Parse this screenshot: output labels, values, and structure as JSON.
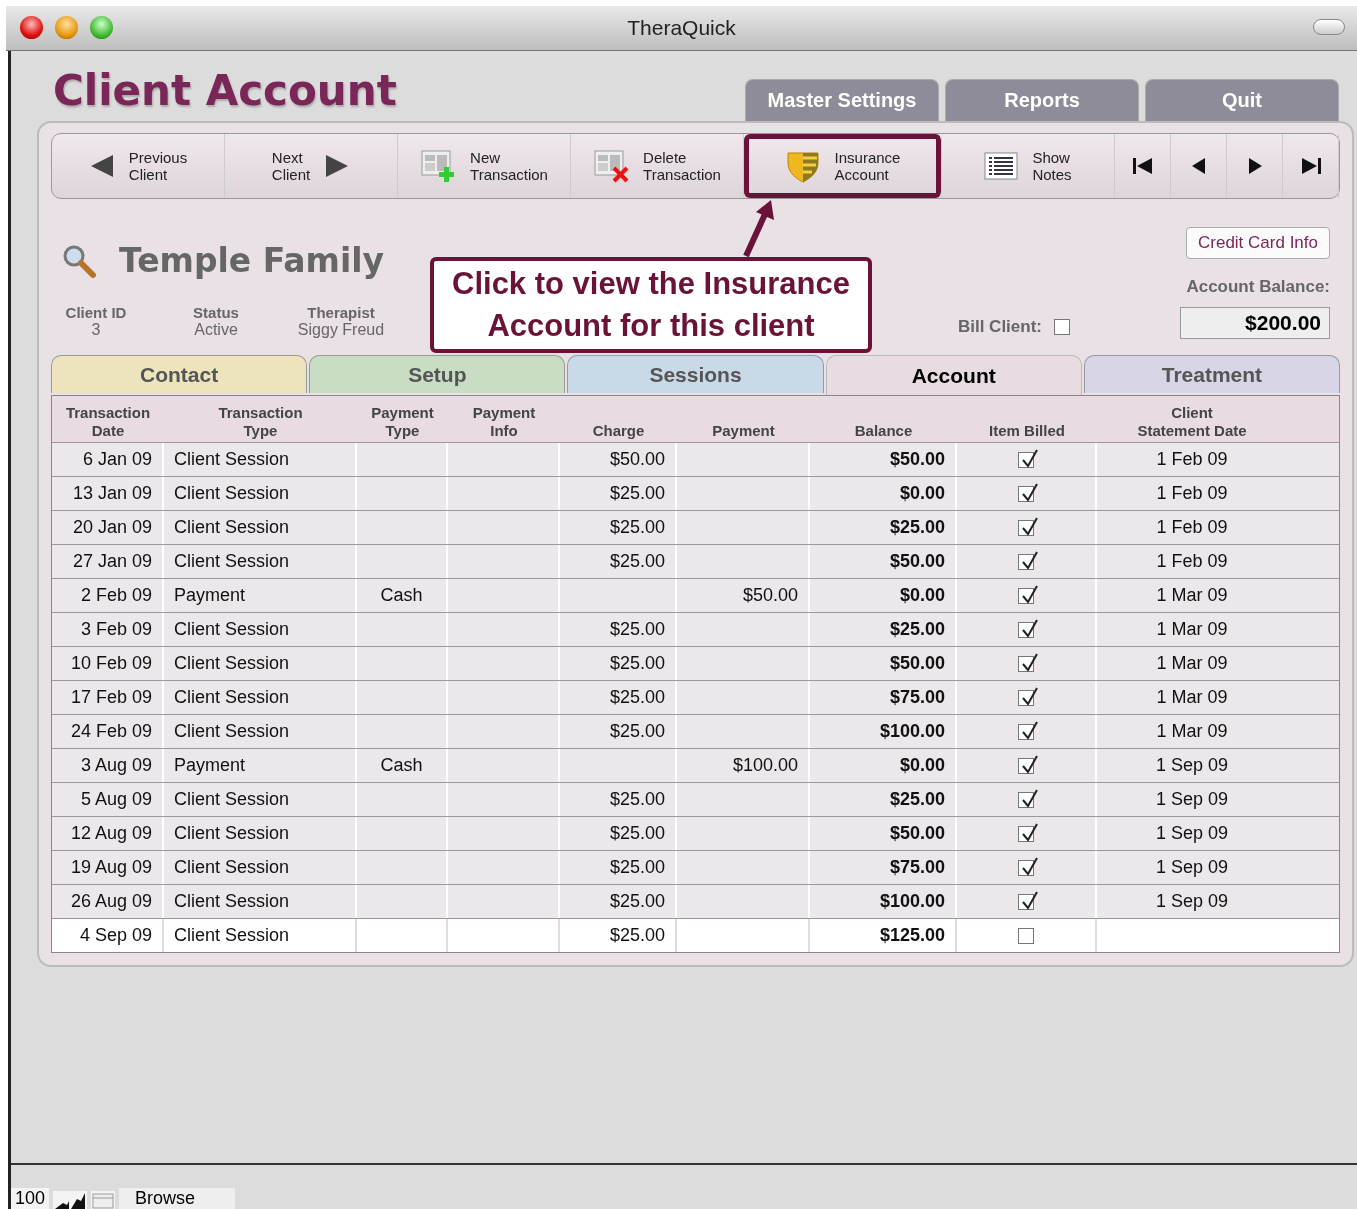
{
  "window": {
    "title": "TheraQuick"
  },
  "header": {
    "title": "Client Account"
  },
  "top_tabs": [
    {
      "label": "Master Settings"
    },
    {
      "label": "Reports"
    },
    {
      "label": "Quit"
    }
  ],
  "toolbar": [
    {
      "kind": "prev",
      "label": "Previous\nClient",
      "highlighted": false
    },
    {
      "kind": "next",
      "label": "Next\nClient",
      "highlighted": false
    },
    {
      "kind": "new",
      "label": "New\nTransaction",
      "highlighted": false
    },
    {
      "kind": "delete",
      "label": "Delete\nTransaction",
      "highlighted": false
    },
    {
      "kind": "insurance",
      "label": "Insurance\nAccount",
      "highlighted": true
    },
    {
      "kind": "notes",
      "label": "Show\nNotes",
      "highlighted": false
    },
    {
      "kind": "first"
    },
    {
      "kind": "back"
    },
    {
      "kind": "forward"
    },
    {
      "kind": "last"
    }
  ],
  "client": {
    "name": "Temple Family",
    "fields": [
      {
        "label": "Client ID",
        "value": "3"
      },
      {
        "label": "Status",
        "value": "Active"
      },
      {
        "label": "Therapist",
        "value": "Siggy Freud"
      }
    ],
    "bill_client": {
      "label": "Bill Client:",
      "checked": false
    },
    "credit_card_button": "Credit Card Info",
    "balance_label": "Account Balance:",
    "balance": "$200.00"
  },
  "callout": "Click to view the Insurance Account for this client",
  "tabs": [
    {
      "label": "Contact",
      "selected": false,
      "color": "#ede3bd"
    },
    {
      "label": "Setup",
      "selected": false,
      "color": "#c9dcc4"
    },
    {
      "label": "Sessions",
      "selected": false,
      "color": "#c9d9e8"
    },
    {
      "label": "Account",
      "selected": true,
      "color": "#e8dbe2"
    },
    {
      "label": "Treatment",
      "selected": false,
      "color": "#d7d5e6"
    }
  ],
  "table": {
    "columns": [
      "Transaction\nDate",
      "Transaction\nType",
      "Payment\nType",
      "Payment\nInfo",
      "Charge",
      "Payment",
      "Balance",
      "Item Billed",
      "Client\nStatement Date"
    ],
    "rows": [
      {
        "date": "6 Jan 09",
        "type": "Client Session",
        "payment_type": "",
        "charge": "$50.00",
        "payment": "",
        "balance": "$50.00",
        "billed": true,
        "statement": "1 Feb 09",
        "selected": false
      },
      {
        "date": "13 Jan 09",
        "type": "Client Session",
        "payment_type": "",
        "charge": "$25.00",
        "payment": "",
        "balance": "$0.00",
        "billed": true,
        "statement": "1 Feb 09",
        "selected": false
      },
      {
        "date": "20 Jan 09",
        "type": "Client Session",
        "payment_type": "",
        "charge": "$25.00",
        "payment": "",
        "balance": "$25.00",
        "billed": true,
        "statement": "1 Feb 09",
        "selected": false
      },
      {
        "date": "27 Jan 09",
        "type": "Client Session",
        "payment_type": "",
        "charge": "$25.00",
        "payment": "",
        "balance": "$50.00",
        "billed": true,
        "statement": "1 Feb 09",
        "selected": false
      },
      {
        "date": "2 Feb 09",
        "type": "Payment",
        "payment_type": "Cash",
        "charge": "",
        "payment": "$50.00",
        "balance": "$0.00",
        "billed": true,
        "statement": "1 Mar 09",
        "selected": false
      },
      {
        "date": "3 Feb 09",
        "type": "Client Session",
        "payment_type": "",
        "charge": "$25.00",
        "payment": "",
        "balance": "$25.00",
        "billed": true,
        "statement": "1 Mar 09",
        "selected": false
      },
      {
        "date": "10 Feb 09",
        "type": "Client Session",
        "payment_type": "",
        "charge": "$25.00",
        "payment": "",
        "balance": "$50.00",
        "billed": true,
        "statement": "1 Mar 09",
        "selected": false
      },
      {
        "date": "17 Feb 09",
        "type": "Client Session",
        "payment_type": "",
        "charge": "$25.00",
        "payment": "",
        "balance": "$75.00",
        "billed": true,
        "statement": "1 Mar 09",
        "selected": false
      },
      {
        "date": "24 Feb 09",
        "type": "Client Session",
        "payment_type": "",
        "charge": "$25.00",
        "payment": "",
        "balance": "$100.00",
        "billed": true,
        "statement": "1 Mar 09",
        "selected": false
      },
      {
        "date": "3 Aug 09",
        "type": "Payment",
        "payment_type": "Cash",
        "charge": "",
        "payment": "$100.00",
        "balance": "$0.00",
        "billed": true,
        "statement": "1 Sep 09",
        "selected": false
      },
      {
        "date": "5 Aug 09",
        "type": "Client Session",
        "payment_type": "",
        "charge": "$25.00",
        "payment": "",
        "balance": "$25.00",
        "billed": true,
        "statement": "1 Sep 09",
        "selected": false
      },
      {
        "date": "12 Aug 09",
        "type": "Client Session",
        "payment_type": "",
        "charge": "$25.00",
        "payment": "",
        "balance": "$50.00",
        "billed": true,
        "statement": "1 Sep 09",
        "selected": false
      },
      {
        "date": "19 Aug 09",
        "type": "Client Session",
        "payment_type": "",
        "charge": "$25.00",
        "payment": "",
        "balance": "$75.00",
        "billed": true,
        "statement": "1 Sep 09",
        "selected": false
      },
      {
        "date": "26 Aug 09",
        "type": "Client Session",
        "payment_type": "",
        "charge": "$25.00",
        "payment": "",
        "balance": "$100.00",
        "billed": true,
        "statement": "1 Sep 09",
        "selected": false
      },
      {
        "date": "4 Sep 09",
        "type": "Client Session",
        "payment_type": "",
        "charge": "$25.00",
        "payment": "",
        "balance": "$125.00",
        "billed": false,
        "statement": "",
        "selected": true
      }
    ]
  },
  "status_bar": {
    "zoom": "100",
    "mode": "Browse"
  }
}
